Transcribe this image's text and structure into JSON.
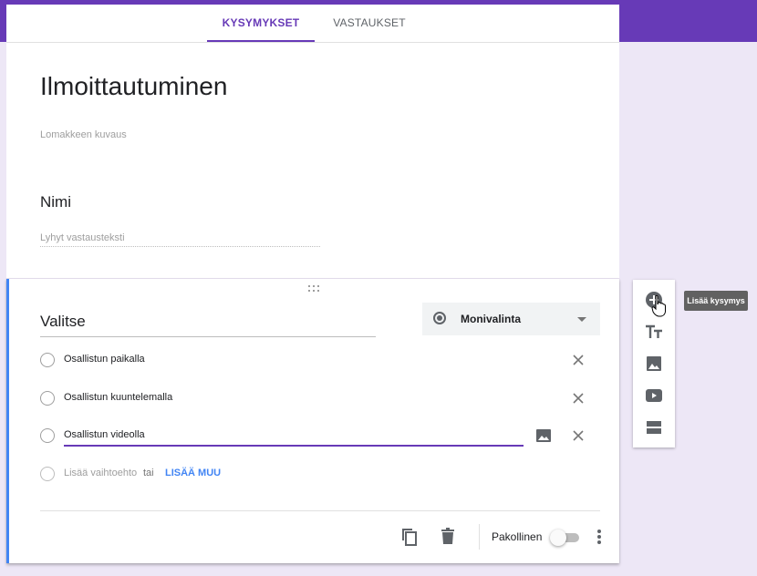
{
  "tabs": {
    "questions": "KYSYMYKSET",
    "answers": "VASTAUKSET"
  },
  "form": {
    "title": "Ilmoittautuminen",
    "description_placeholder": "Lomakkeen kuvaus"
  },
  "question1": {
    "title": "Nimi",
    "answer_placeholder": "Lyhyt vastausteksti"
  },
  "question2": {
    "title": "Valitse",
    "type_label": "Monivalinta",
    "options": [
      "Osallistun paikalla",
      "Osallistun kuuntelemalla",
      "Osallistun videolla"
    ],
    "add_option_label": "Lisää vaihtoehto",
    "or_label": "tai",
    "add_other_label": "LISÄÄ MUU",
    "required_label": "Pakollinen",
    "required": false
  },
  "toolbar": {
    "tooltip": "Lisää kysymys",
    "tools": [
      "add-question-icon",
      "title-text-icon",
      "image-icon",
      "video-icon",
      "section-icon"
    ]
  },
  "colors": {
    "accent": "#673ab7",
    "background": "#ede7f6",
    "active_border": "#4285f4",
    "link": "#4285f4"
  }
}
